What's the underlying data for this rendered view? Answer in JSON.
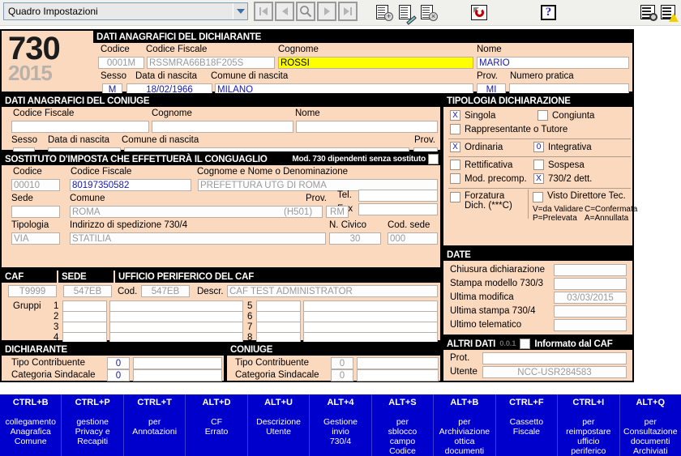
{
  "toolbar": {
    "combo_value": "Quadro Impostazioni",
    "nav": {
      "first": "first-record",
      "prev": "previous-record",
      "search": "search",
      "next": "next-record",
      "last": "last-record"
    },
    "icons": {
      "new": "new-document-icon",
      "edit": "edit-document-icon",
      "delete": "delete-document-icon",
      "refresh": "refresh-icon",
      "help": "help-icon",
      "settings": "settings-document-icon",
      "warning": "warning-document-icon"
    }
  },
  "logo": {
    "model": "730",
    "year": "2015"
  },
  "dichiarante": {
    "title": "DATI ANAGRAFICI DEL DICHIARANTE",
    "labels": {
      "codice": "Codice",
      "codice_fiscale": "Codice Fiscale",
      "cognome": "Cognome",
      "nome": "Nome",
      "sesso": "Sesso",
      "data_nascita": "Data di nascita",
      "comune_nascita": "Comune di nascita",
      "prov": "Prov.",
      "numero_pratica": "Numero pratica"
    },
    "values": {
      "codice": "0001M",
      "codice_fiscale": "RSSMRA66B18F205S",
      "cognome": "ROSSI",
      "nome": "MARIO",
      "sesso": "M",
      "data_nascita": "18/02/1966",
      "comune_nascita": "MILANO",
      "prov": "MI",
      "numero_pratica": ""
    }
  },
  "coniuge": {
    "title": "DATI ANAGRAFICI DEL CONIUGE",
    "labels": {
      "codice_fiscale": "Codice Fiscale",
      "cognome": "Cognome",
      "nome": "Nome",
      "sesso": "Sesso",
      "data_nascita": "Data di nascita",
      "comune_nascita": "Comune di nascita",
      "prov": "Prov."
    },
    "values": {
      "codice_fiscale": "",
      "cognome": "",
      "nome": "",
      "sesso": "",
      "data_nascita": "",
      "comune_nascita": "",
      "prov": ""
    }
  },
  "sostituto": {
    "title": "SOSTITUTO D'IMPOSTA CHE EFFETTUERÀ IL CONGUAGLIO",
    "note": "Mod. 730 dipendenti senza sostituto",
    "note_checked": "",
    "labels": {
      "codice": "Codice",
      "codice_fiscale": "Codice Fiscale",
      "denominazione": "Cognome e Nome o Denominazione",
      "sede": "Sede",
      "comune": "Comune",
      "prov": "Prov.",
      "tel": "Tel.",
      "fax": "Fax",
      "tipologia": "Tipologia",
      "indirizzo": "Indirizzo di spedizione 730/4",
      "civico": "N. Civico",
      "cod_sede": "Cod. sede"
    },
    "values": {
      "codice": "00010",
      "codice_fiscale": "80197350582",
      "denominazione": "PREFETTURA UTG DI ROMA",
      "sede": "",
      "comune": "ROMA",
      "comune_cod": "(H501)",
      "prov": "RM",
      "tel": "",
      "fax": "",
      "tipologia": "VIA",
      "indirizzo": "STATILIA",
      "civico": "30",
      "cod_sede": "000"
    }
  },
  "caf": {
    "title_caf": "CAF",
    "title_sede": "SEDE",
    "title_ufficio": "UFFICIO PERIFERICO DEL CAF",
    "labels": {
      "cod": "Cod.",
      "descr": "Descr.",
      "gruppi": "Gruppi"
    },
    "values": {
      "caf": "T9999",
      "sede": "547EB",
      "cod": "547EB",
      "descr": "CAF TEST ADMINISTRATOR"
    },
    "gruppi_left": [
      {
        "num": "1",
        "code": "",
        "desc": ""
      },
      {
        "num": "2",
        "code": "",
        "desc": ""
      },
      {
        "num": "3",
        "code": "",
        "desc": ""
      },
      {
        "num": "4",
        "code": "",
        "desc": ""
      }
    ],
    "gruppi_right": [
      {
        "num": "5",
        "code": "",
        "desc": ""
      },
      {
        "num": "6",
        "code": "",
        "desc": ""
      },
      {
        "num": "7",
        "code": "",
        "desc": ""
      },
      {
        "num": "8",
        "code": "",
        "desc": ""
      }
    ]
  },
  "contribuente": {
    "dichiarante_title": "DICHIARANTE",
    "coniuge_title": "CONIUGE",
    "labels": {
      "tipo": "Tipo Contribuente",
      "categoria": "Categoria Sindacale"
    },
    "dichiarante": {
      "tipo_code": "0",
      "tipo_desc": "",
      "categoria_code": "0",
      "categoria_desc": ""
    },
    "coniuge": {
      "tipo_code": "0",
      "tipo_desc": "",
      "categoria_code": "0",
      "categoria_desc": ""
    }
  },
  "tipologia": {
    "title": "TIPOLOGIA DICHIARAZIONE",
    "items": [
      {
        "label": "Singola",
        "value": "X"
      },
      {
        "label": "Congiunta",
        "value": ""
      },
      {
        "label": "Rappresentante o Tutore",
        "value": ""
      },
      {
        "label": "Ordinaria",
        "value": "X"
      },
      {
        "label": "Integrativa",
        "value": "0"
      },
      {
        "label": "Rettificativa",
        "value": ""
      },
      {
        "label": "Sospesa",
        "value": ""
      },
      {
        "label": "Mod. precomp.",
        "value": ""
      },
      {
        "label": "730/2 dett.",
        "value": "X"
      }
    ],
    "forzatura": {
      "label_1": "Forzatura",
      "label_2": "Dich. (***C)",
      "value": ""
    },
    "visto": {
      "label": "Visto Direttore Tec.",
      "value": "",
      "legend_1": "V=da Validare",
      "legend_2": "C=Confermata",
      "legend_3": "P=Prelevata",
      "legend_4": "A=Annullata"
    }
  },
  "date": {
    "title": "DATE",
    "rows": [
      {
        "label": "Chiusura dichiarazione",
        "value": ""
      },
      {
        "label": "Stampa modello 730/3",
        "value": ""
      },
      {
        "label": "Ultima modifica",
        "value": "03/03/2015"
      },
      {
        "label": "Ultima stampa 730/4",
        "value": ""
      },
      {
        "label": "Ultimo telematico",
        "value": ""
      }
    ]
  },
  "altri_dati": {
    "title": "ALTRI DATI",
    "version": "0.0.1",
    "informato_label": "Informato dal CAF",
    "informato_value": "",
    "rows": [
      {
        "label": "Prot.",
        "value": ""
      },
      {
        "label": "Utente",
        "value": "NCC-USR284583"
      }
    ]
  },
  "function_bar": [
    {
      "key": "CTRL+B",
      "desc": "collegamento\nAnagrafica\nComune"
    },
    {
      "key": "CTRL+P",
      "desc": "gestione\nPrivacy e\nRecapiti"
    },
    {
      "key": "CTRL+T",
      "desc": "per\nAnnotazioni"
    },
    {
      "key": "ALT+D",
      "desc": "CF\nErrato"
    },
    {
      "key": "ALT+U",
      "desc": "Descrizione\nUtente"
    },
    {
      "key": "ALT+4",
      "desc": "Gestione\ninvio\n730/4"
    },
    {
      "key": "ALT+S",
      "desc": "per\nsblocco\ncampo\nCodice"
    },
    {
      "key": "ALT+B",
      "desc": "per\nArchiviazione\nottica\ndocumenti"
    },
    {
      "key": "CTRL+F",
      "desc": "Cassetto\nFiscale"
    },
    {
      "key": "CTRL+I",
      "desc": "per\nreimpostare\nufficio\nperiferico"
    },
    {
      "key": "ALT+Q",
      "desc": "per\nConsultazione\ndocumenti\nArchiviati"
    }
  ],
  "colors": {
    "panel_bg": "#fbd9bf",
    "header_bg": "#000000",
    "field_text": "#1818b0",
    "readonly_text": "#9a9a9a",
    "highlight": "#ffff00",
    "fbar_bg": "#0000cc"
  }
}
